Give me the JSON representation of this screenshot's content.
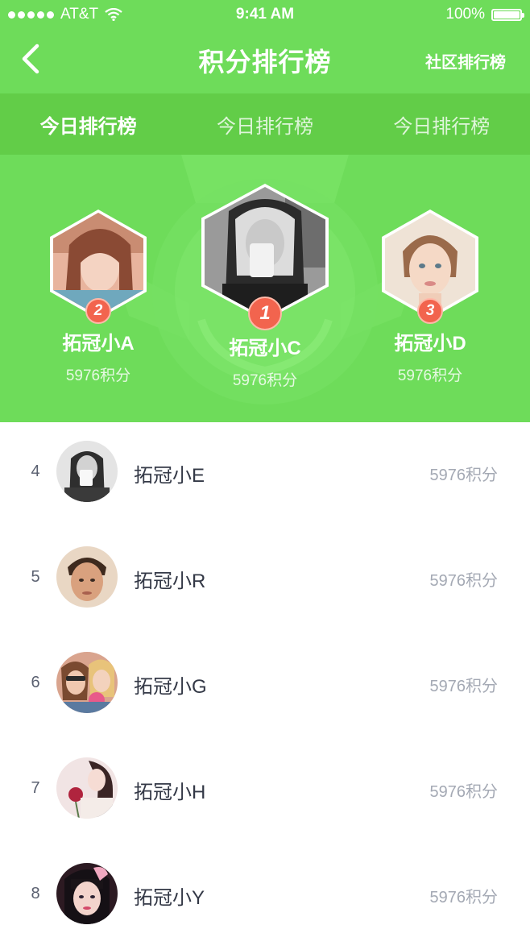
{
  "status_bar": {
    "carrier": "AT&T",
    "time": "9:41 AM",
    "battery": "100%"
  },
  "nav": {
    "title": "积分排行榜",
    "right_link": "社区排行榜",
    "back_icon": "chevron-left-icon"
  },
  "tabs": [
    {
      "label": "今日排行榜",
      "active": true
    },
    {
      "label": "今日排行榜",
      "active": false
    },
    {
      "label": "今日排行榜",
      "active": false
    }
  ],
  "podium": [
    {
      "rank": "2",
      "name": "拓冠小A",
      "score": "5976积分"
    },
    {
      "rank": "1",
      "name": "拓冠小C",
      "score": "5976积分"
    },
    {
      "rank": "3",
      "name": "拓冠小D",
      "score": "5976积分"
    }
  ],
  "list": [
    {
      "rank": "4",
      "name": "拓冠小E",
      "score": "5976积分"
    },
    {
      "rank": "5",
      "name": "拓冠小R",
      "score": "5976积分"
    },
    {
      "rank": "6",
      "name": "拓冠小G",
      "score": "5976积分"
    },
    {
      "rank": "7",
      "name": "拓冠小H",
      "score": "5976积分"
    },
    {
      "rank": "8",
      "name": "拓冠小Y",
      "score": "5976积分"
    }
  ],
  "colors": {
    "header_green": "#6edc5a",
    "tab_bar_green": "#62cd48",
    "rank_badge": "#f2644e",
    "name_text": "#333846",
    "score_text": "#a4a9b4"
  }
}
